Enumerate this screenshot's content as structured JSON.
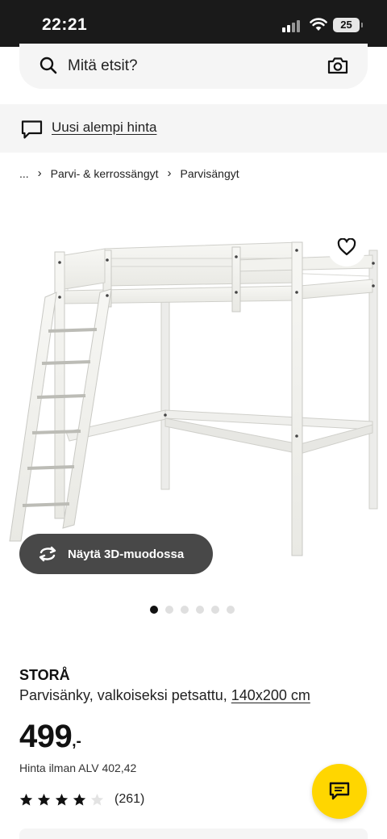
{
  "status_bar": {
    "time": "22:21",
    "battery": "25"
  },
  "search": {
    "placeholder": "Mitä etsit?"
  },
  "notice": {
    "link_text": "Uusi alempi hinta"
  },
  "breadcrumb": {
    "ellipsis": "...",
    "items": [
      "Parvi- & kerrossängyt",
      "Parvisängyt"
    ]
  },
  "gallery": {
    "view_3d_label": "Näytä 3D-muodossa",
    "image_count": 6,
    "active_index": 0
  },
  "product": {
    "name": "STORÅ",
    "description": "Parvisänky, valkoiseksi petsattu, ",
    "size": "140x200 cm",
    "price": "499",
    "price_suffix": ",-",
    "price_vat": "Hinta ilman ALV 402,42",
    "rating_stars": 4,
    "rating_count": "(261)"
  },
  "colors": {
    "accent_yellow": "#ffd600",
    "text": "#111111",
    "surface": "#f5f5f5"
  }
}
